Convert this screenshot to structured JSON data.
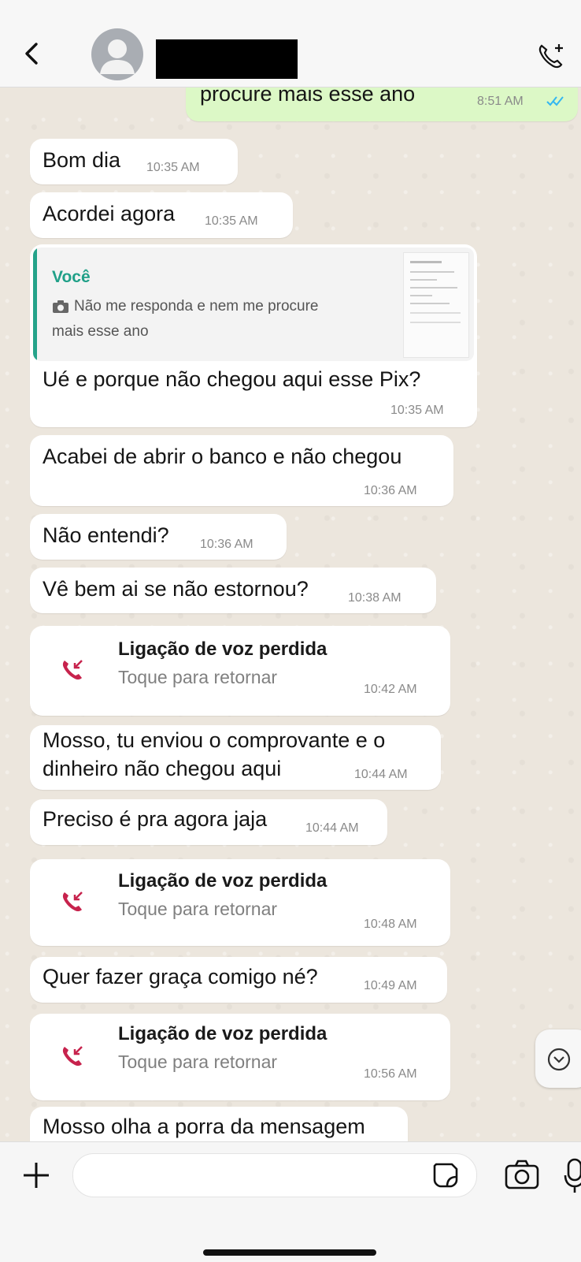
{
  "header": {
    "contact_name": ""
  },
  "messages": {
    "out_partial": {
      "text": "procure mais esse ano",
      "time": "8:51 AM"
    },
    "m1": {
      "text": "Bom dia",
      "time": "10:35 AM"
    },
    "m2": {
      "text": "Acordei agora",
      "time": "10:35 AM"
    },
    "reply": {
      "quoted_author": "Você",
      "quoted_line1": "Não me responda e nem me procure",
      "quoted_line2": "mais esse ano",
      "text": "Ué e porque não chegou aqui esse Pix?",
      "time": "10:35 AM"
    },
    "m4": {
      "text": "Acabei de abrir o banco e não chegou",
      "time": "10:36 AM"
    },
    "m5": {
      "text": "Não entendi?",
      "time": "10:36 AM"
    },
    "m6": {
      "text": "Vê bem ai se não estornou?",
      "time": "10:38 AM"
    },
    "call1": {
      "title": "Ligação de voz perdida",
      "subtitle": "Toque para retornar",
      "time": "10:42 AM"
    },
    "m7": {
      "line1": "Mosso, tu enviou o comprovante e o",
      "line2": "dinheiro não chegou aqui",
      "time": "10:44 AM"
    },
    "m8": {
      "text": "Preciso é pra agora jaja",
      "time": "10:44 AM"
    },
    "call2": {
      "title": "Ligação de voz perdida",
      "subtitle": "Toque para retornar",
      "time": "10:48 AM"
    },
    "m9": {
      "text": "Quer fazer graça comigo né?",
      "time": "10:49 AM"
    },
    "call3": {
      "title": "Ligação de voz perdida",
      "subtitle": "Toque para retornar",
      "time": "10:56 AM"
    },
    "m10": {
      "text": "Mosso olha a porra da mensagem"
    }
  },
  "composer": {
    "placeholder": ""
  },
  "colors": {
    "accent_green": "#25a38a",
    "missed_call_red": "#c7234d",
    "read_ticks": "#34b7f1"
  }
}
